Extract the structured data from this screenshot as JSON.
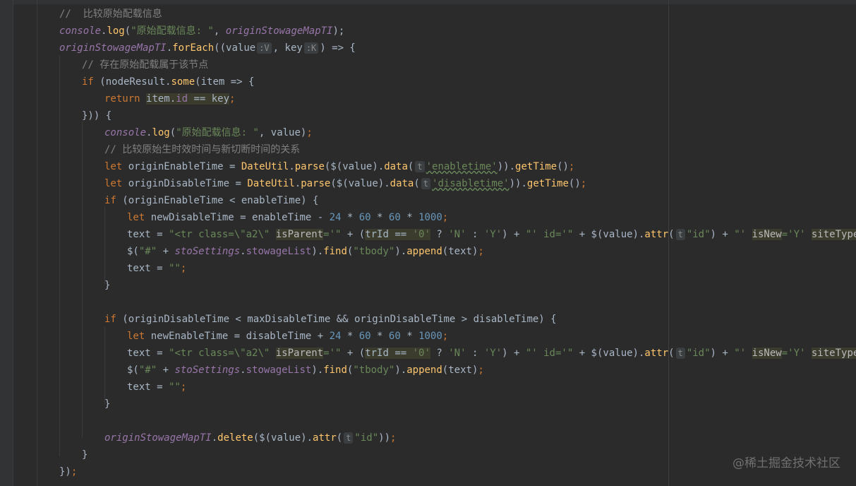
{
  "editor": {
    "language": "javascript",
    "comments": {
      "c1": "//  比较原始配载信息",
      "c2": "// 存在原始配载属于该节点",
      "c3": "// 比较原始生时效时间与新切断时间的关系"
    },
    "strings": {
      "s_info": "\"原始配载信息: \"",
      "s_enable": "'enabletime'",
      "s_disable": "'disabletime'",
      "s_tr1": "\"<tr class=\\\"a2\\\" ",
      "s_eqq": "='\"",
      "s_zero": "'0'",
      "s_N": "'N'",
      "s_Y": "'Y'",
      "s_id1": "\"' id='\"",
      "s_id": "\"id\"",
      "s_isnew": "\"' ",
      "s_Y2": "'Y'",
      "s_sitetype": "='\"",
      "s_hash": "\"#\"",
      "s_tbody": "\"tbody\"",
      "s_empty": "\"\""
    },
    "hints": {
      "v": "V",
      "k": "K",
      "t": "t"
    },
    "numbers": {
      "n24": "24",
      "n60": "60",
      "n1000": "1000"
    }
  },
  "watermark": "@稀土掘金技术社区"
}
